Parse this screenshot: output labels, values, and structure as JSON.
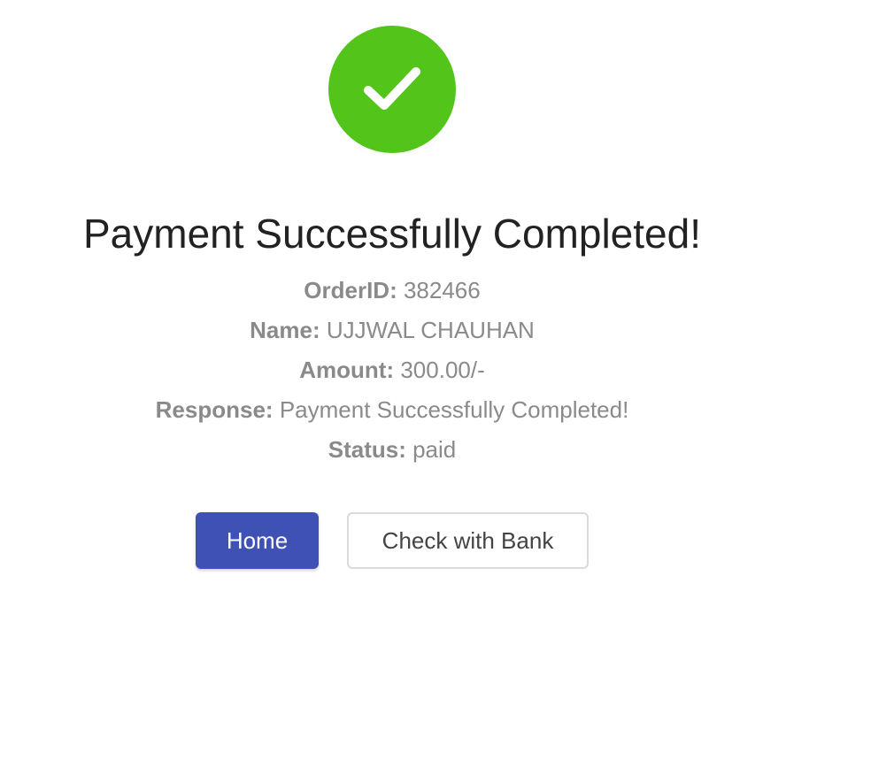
{
  "status_icon": {
    "icon": "check-icon",
    "color": "#52c41a"
  },
  "title": "Payment Successfully Completed!",
  "details": [
    {
      "label": "OrderID:",
      "value": "382466"
    },
    {
      "label": "Name:",
      "value": "UJJWAL CHAUHAN"
    },
    {
      "label": "Amount:",
      "value": "300.00/-"
    },
    {
      "label": "Response:",
      "value": "Payment Successfully Completed!"
    },
    {
      "label": "Status:",
      "value": "paid"
    }
  ],
  "buttons": {
    "home_label": "Home",
    "bank_label": "Check with Bank",
    "primary_color": "#3f51b5"
  }
}
